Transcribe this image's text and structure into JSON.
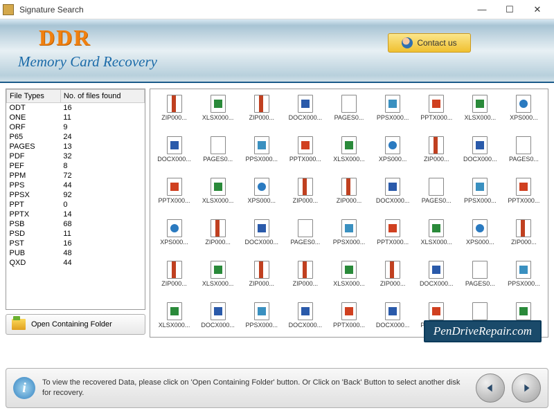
{
  "window": {
    "title": "Signature Search"
  },
  "banner": {
    "brand": "DDR",
    "subtitle": "Memory Card Recovery",
    "contact_label": "Contact us"
  },
  "table": {
    "headers": {
      "col1": "File Types",
      "col2": "No. of files found"
    },
    "rows": [
      {
        "type": "ODT",
        "count": 16
      },
      {
        "type": "ONE",
        "count": 11
      },
      {
        "type": "ORF",
        "count": 9
      },
      {
        "type": "P65",
        "count": 24
      },
      {
        "type": "PAGES",
        "count": 13
      },
      {
        "type": "PDF",
        "count": 32
      },
      {
        "type": "PEF",
        "count": 8
      },
      {
        "type": "PPM",
        "count": 72
      },
      {
        "type": "PPS",
        "count": 44
      },
      {
        "type": "PPSX",
        "count": 92
      },
      {
        "type": "PPT",
        "count": 0
      },
      {
        "type": "PPTX",
        "count": 14
      },
      {
        "type": "PSB",
        "count": 68
      },
      {
        "type": "PSD",
        "count": 11
      },
      {
        "type": "PST",
        "count": 16
      },
      {
        "type": "PUB",
        "count": 48
      },
      {
        "type": "QXD",
        "count": 44
      }
    ]
  },
  "open_button_label": "Open Containing Folder",
  "files": [
    {
      "n": "ZIP000...",
      "t": "zip"
    },
    {
      "n": "XLSX000...",
      "t": "xlsx"
    },
    {
      "n": "ZIP000...",
      "t": "zip"
    },
    {
      "n": "DOCX000...",
      "t": "docx"
    },
    {
      "n": "PAGES0...",
      "t": "pages"
    },
    {
      "n": "PPSX000...",
      "t": "ppsx"
    },
    {
      "n": "PPTX000...",
      "t": "pptx"
    },
    {
      "n": "XLSX000...",
      "t": "xlsx"
    },
    {
      "n": "XPS000...",
      "t": "xps"
    },
    {
      "n": "DOCX000...",
      "t": "docx"
    },
    {
      "n": "PAGES0...",
      "t": "pages"
    },
    {
      "n": "PPSX000...",
      "t": "ppsx"
    },
    {
      "n": "PPTX000...",
      "t": "pptx"
    },
    {
      "n": "XLSX000...",
      "t": "xlsx"
    },
    {
      "n": "XPS000...",
      "t": "xps"
    },
    {
      "n": "ZIP000...",
      "t": "zip"
    },
    {
      "n": "DOCX000...",
      "t": "docx"
    },
    {
      "n": "PAGES0...",
      "t": "pages"
    },
    {
      "n": "PPTX000...",
      "t": "pptx"
    },
    {
      "n": "XLSX000...",
      "t": "xlsx"
    },
    {
      "n": "XPS000...",
      "t": "xps"
    },
    {
      "n": "ZIP000...",
      "t": "zip"
    },
    {
      "n": "ZIP000...",
      "t": "zip"
    },
    {
      "n": "DOCX000...",
      "t": "docx"
    },
    {
      "n": "PAGES0...",
      "t": "pages"
    },
    {
      "n": "PPSX000...",
      "t": "ppsx"
    },
    {
      "n": "PPTX000...",
      "t": "pptx"
    },
    {
      "n": "XPS000...",
      "t": "xps"
    },
    {
      "n": "ZIP000...",
      "t": "zip"
    },
    {
      "n": "DOCX000...",
      "t": "docx"
    },
    {
      "n": "PAGES0...",
      "t": "pages"
    },
    {
      "n": "PPSX000...",
      "t": "ppsx"
    },
    {
      "n": "PPTX000...",
      "t": "pptx"
    },
    {
      "n": "XLSX000...",
      "t": "xlsx"
    },
    {
      "n": "XPS000...",
      "t": "xps"
    },
    {
      "n": "ZIP000...",
      "t": "zip"
    },
    {
      "n": "ZIP000...",
      "t": "zip"
    },
    {
      "n": "XLSX000...",
      "t": "xlsx"
    },
    {
      "n": "ZIP000...",
      "t": "zip"
    },
    {
      "n": "ZIP000...",
      "t": "zip"
    },
    {
      "n": "XLSX000...",
      "t": "xlsx"
    },
    {
      "n": "ZIP000...",
      "t": "zip"
    },
    {
      "n": "DOCX000...",
      "t": "docx"
    },
    {
      "n": "PAGES0...",
      "t": "pages"
    },
    {
      "n": "PPSX000...",
      "t": "ppsx"
    },
    {
      "n": "XLSX000...",
      "t": "xlsx"
    },
    {
      "n": "DOCX000...",
      "t": "docx"
    },
    {
      "n": "PPSX000...",
      "t": "ppsx"
    },
    {
      "n": "DOCX000...",
      "t": "docx"
    },
    {
      "n": "PPTX000...",
      "t": "pptx"
    },
    {
      "n": "DOCX000...",
      "t": "docx"
    },
    {
      "n": "PPTX000...",
      "t": "pptx"
    },
    {
      "n": "PAGES0...",
      "t": "pages"
    },
    {
      "n": "XLSX000...",
      "t": "xlsx"
    }
  ],
  "watermark": "PenDriveRepair.com",
  "footer": {
    "text": "To view the recovered Data, please click on 'Open Containing Folder' button. Or Click on 'Back' Button to select another disk for recovery."
  }
}
